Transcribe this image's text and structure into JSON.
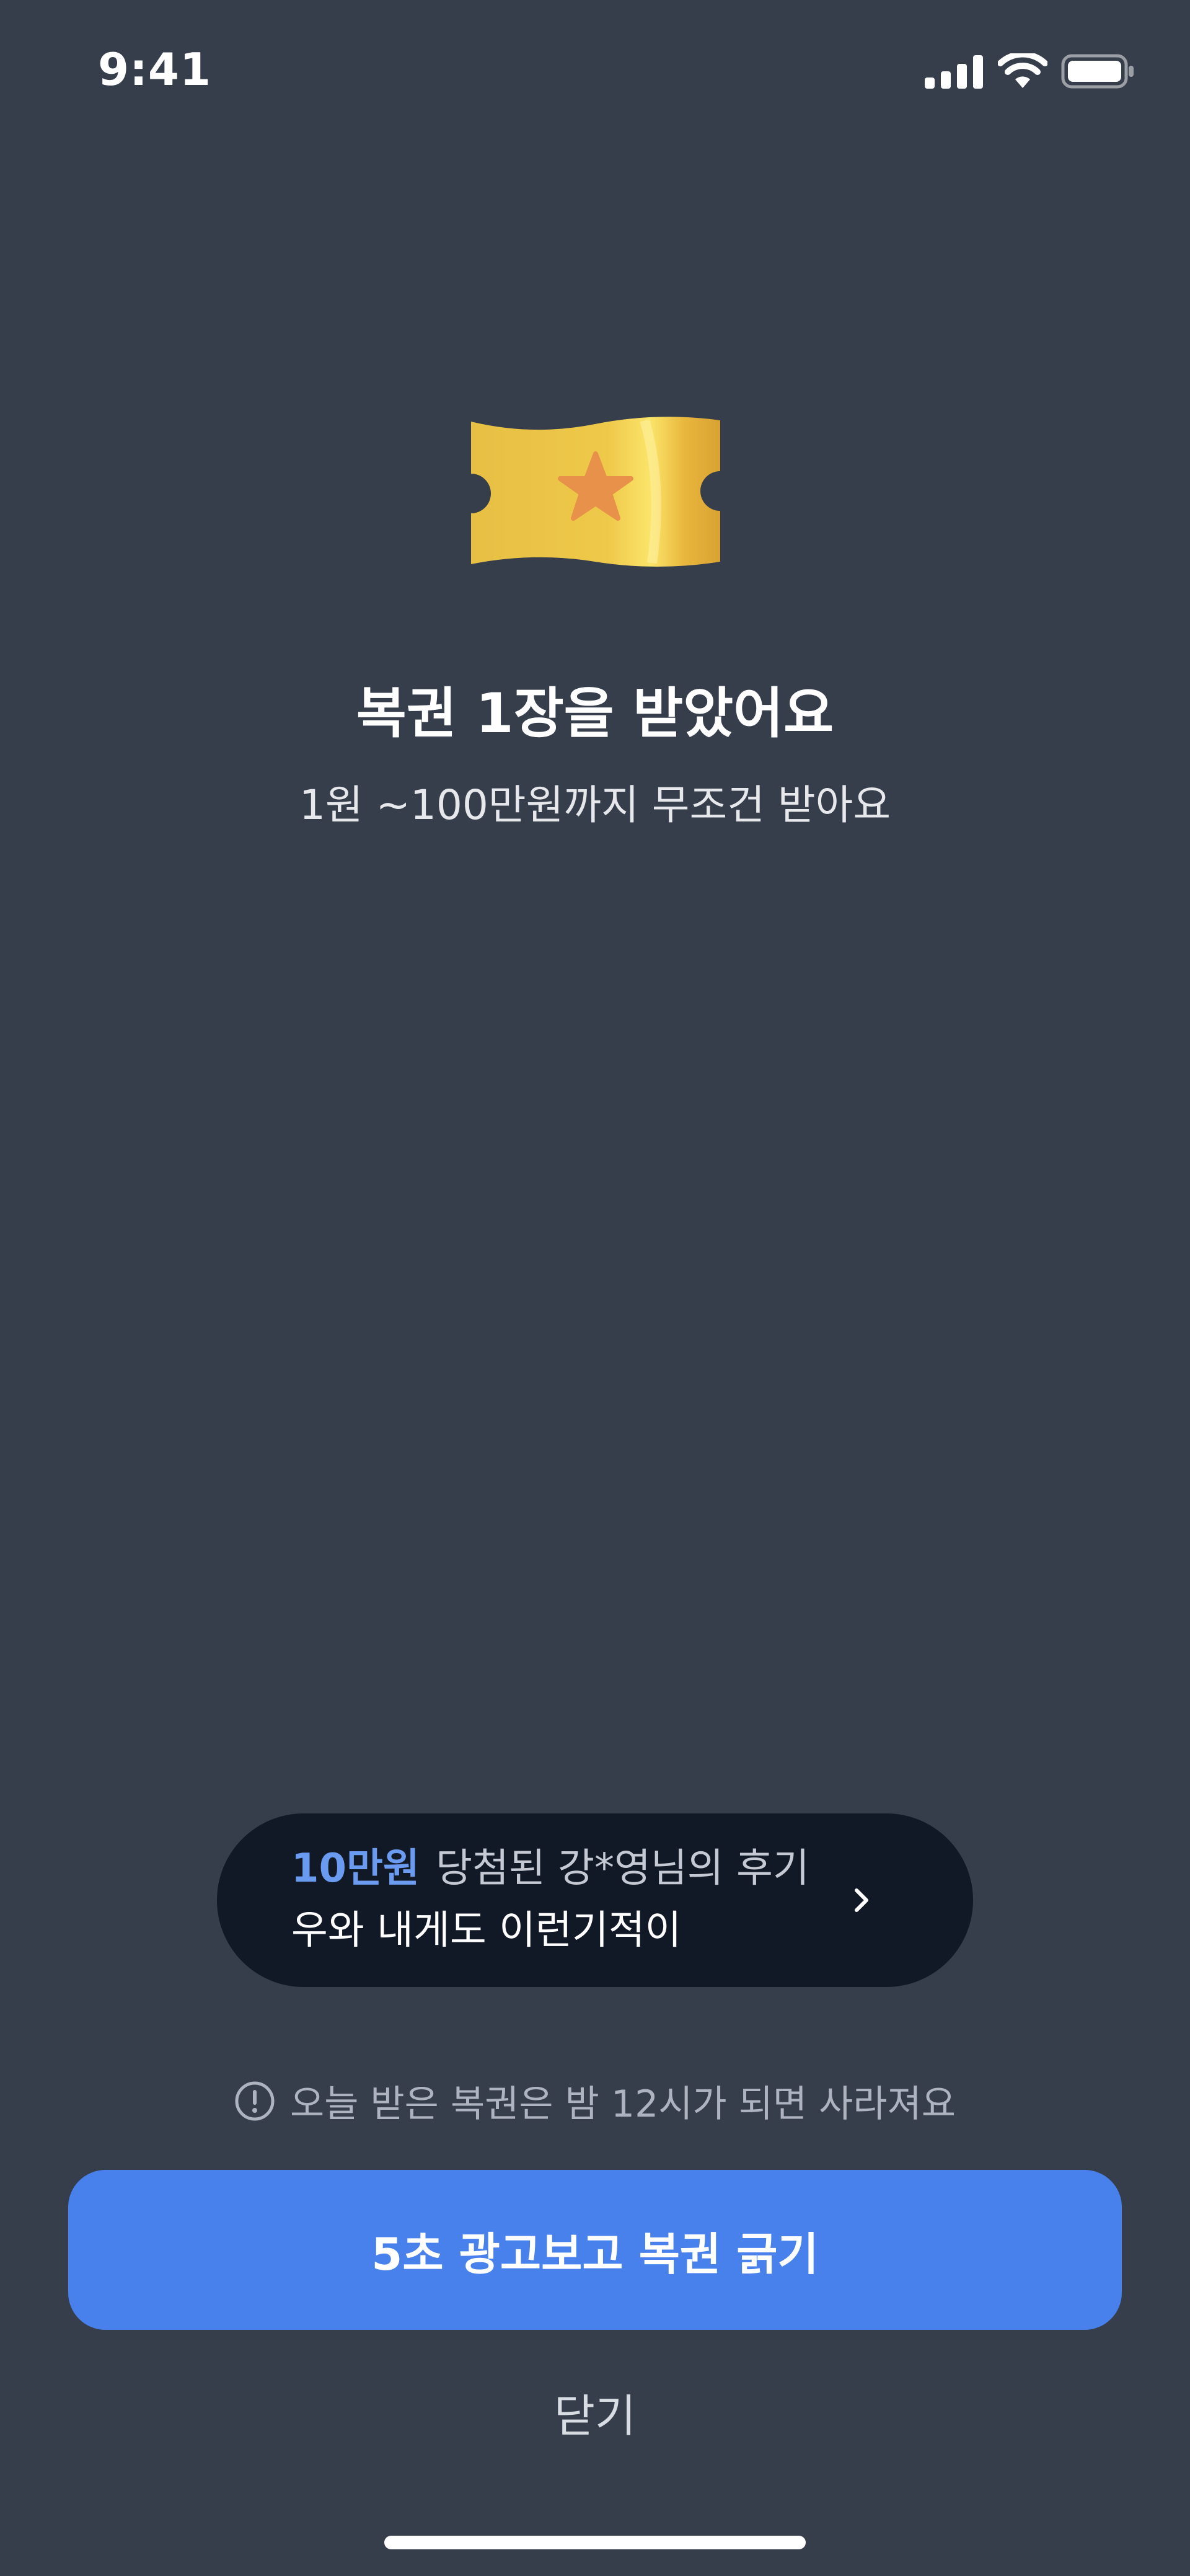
{
  "status_bar": {
    "time": "9:41",
    "icons": [
      "signal-icon",
      "wifi-icon",
      "battery-icon"
    ]
  },
  "hero": {
    "icon": "lottery-ticket-icon",
    "title": "복권 1장을 받았어요",
    "subtitle": "1원 ~100만원까지 무조건 받아요"
  },
  "review": {
    "amount": "10만원",
    "headline_rest": "당첨된 강*영님의 후기",
    "quote": "우와 내게도 이런기적이",
    "arrow_icon": "chevron-right-icon"
  },
  "notice": {
    "icon": "info-circle-icon",
    "text": "오늘 받은 복권은 밤 12시가 되면 사라져요"
  },
  "actions": {
    "primary_label": "5초 광고보고 복권 긁기",
    "close_label": "닫기"
  },
  "colors": {
    "background": "#363d4b",
    "card": "#111826",
    "accent": "#4881eb",
    "amount_highlight": "#6b9bf0",
    "ticket_gold": "#f0c944",
    "ticket_star": "#e8914a"
  }
}
